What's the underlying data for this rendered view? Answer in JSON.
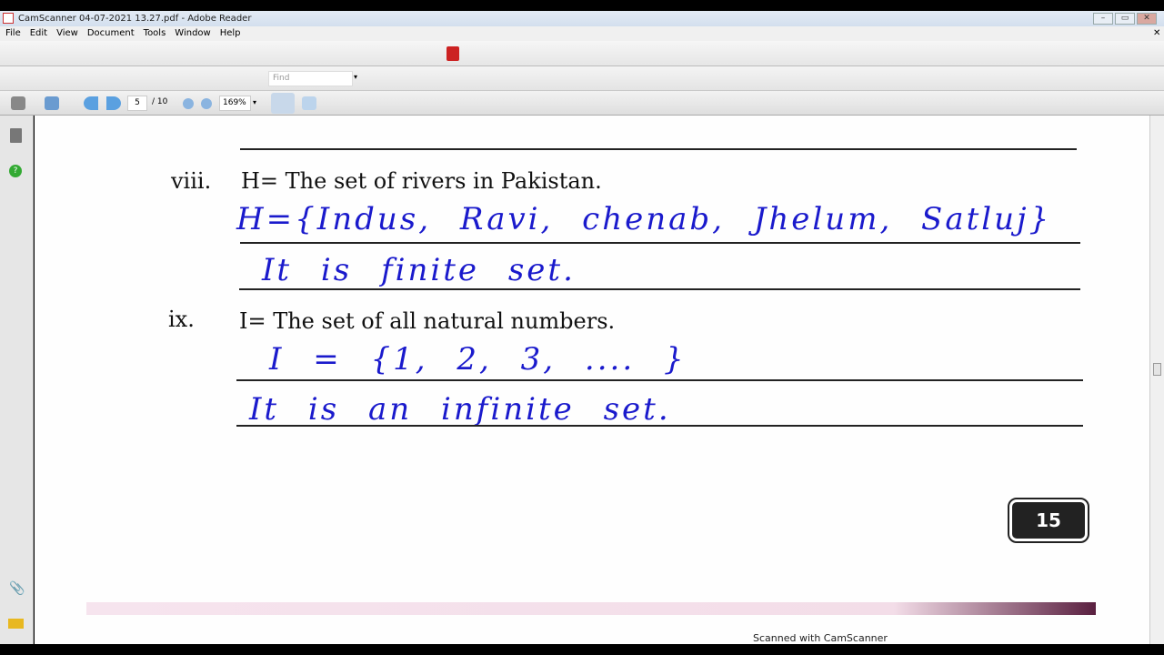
{
  "window": {
    "title": "CamScanner 04-07-2021 13.27.pdf - Adobe Reader",
    "minimize": "–",
    "maximize": "▭",
    "close": "✕"
  },
  "menu": [
    "File",
    "Edit",
    "View",
    "Document",
    "Tools",
    "Window",
    "Help"
  ],
  "find": {
    "placeholder": "Find"
  },
  "nav": {
    "page": "5",
    "total": "/ 10",
    "zoom": "169%"
  },
  "document": {
    "items": [
      {
        "num": "viii.",
        "question": "H= The set of rivers in Pakistan.",
        "answer1": "H={Indus, Ravi, chenab, Jhelum, Satluj}",
        "answer2": "It is finite set."
      },
      {
        "num": "ix.",
        "question": "I= The set of all natural numbers.",
        "answer1": "I = {1, 2, 3, .... }",
        "answer2": "It is an infinite set."
      }
    ],
    "page_number": "15",
    "footer": "Scanned with CamScanner"
  }
}
